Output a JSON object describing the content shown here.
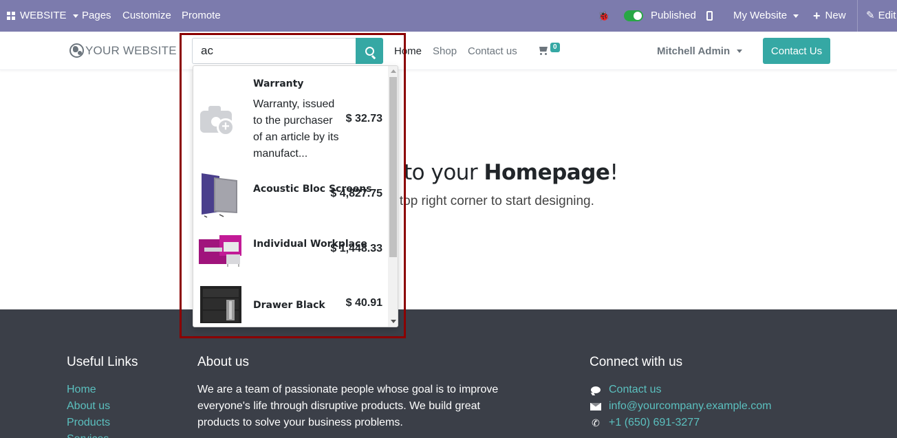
{
  "admin_bar": {
    "app_label": "WEBSITE",
    "menu": [
      "Pages",
      "Customize",
      "Promote"
    ],
    "published_label": "Published",
    "website_selector": "My Website",
    "new_label": "New",
    "edit_label": "Edit"
  },
  "nav": {
    "logo_text": "YOUR WEBSITE",
    "search_value": "ac",
    "links": [
      "Home",
      "Shop",
      "Contact us"
    ],
    "cart_count": "0",
    "user": "Mitchell Admin",
    "contact_button": "Contact Us"
  },
  "hero": {
    "title_prefix": "to your ",
    "title_bold": "Homepage",
    "title_suffix": "!",
    "subtitle": "e top right corner to start designing."
  },
  "search_results": [
    {
      "name": "Warranty",
      "description": "Warranty, issued to the purchaser of an article by its manufact...",
      "price": "$ 32.73",
      "image": "camera-placeholder-icon"
    },
    {
      "name": "Acoustic Bloc Screens",
      "description": "",
      "price": "$ 4,827.75",
      "image": "acoustic-screen-image"
    },
    {
      "name": "Individual Workplace",
      "description": "",
      "price": "$ 1,448.33",
      "image": "workplace-image"
    },
    {
      "name": "Drawer Black",
      "description": "",
      "price": "$ 40.91",
      "image": "drawer-image"
    }
  ],
  "footer": {
    "useful_links_title": "Useful Links",
    "useful_links": [
      "Home",
      "About us",
      "Products",
      "Services"
    ],
    "about_title": "About us",
    "about_text": "We are a team of passionate people whose goal is to improve everyone's life through disruptive products. We build great products to solve your business problems.",
    "connect_title": "Connect with us",
    "connect_contact": "Contact us",
    "connect_email": "info@yourcompany.example.com",
    "connect_phone": "+1 (650) 691-3277"
  },
  "colors": {
    "admin_bar": "#7c7bad",
    "accent": "#35a8a4",
    "footer_bg": "#3b3f48",
    "highlight": "#8b0000"
  }
}
